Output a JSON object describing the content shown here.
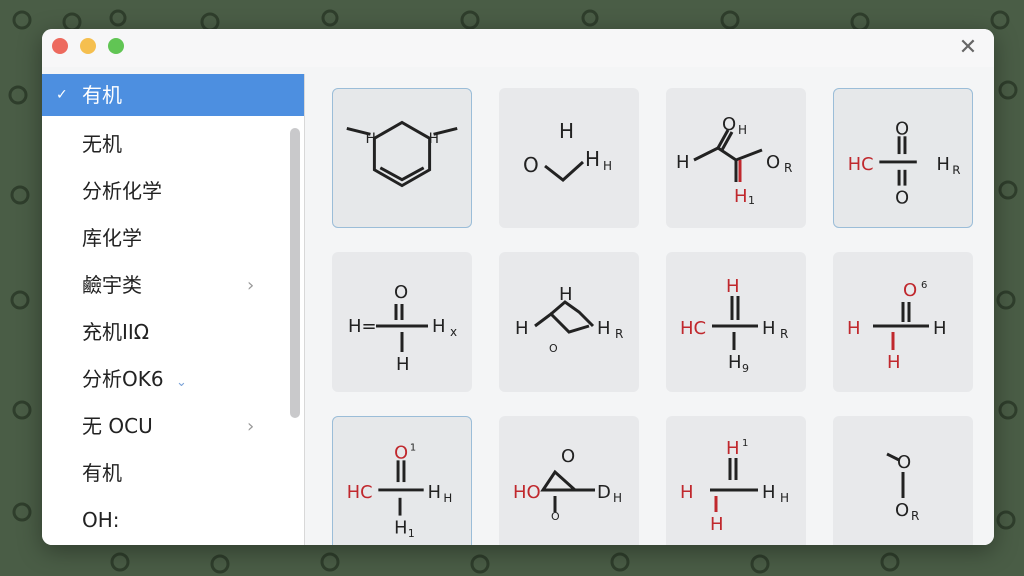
{
  "sidebar": {
    "items": [
      {
        "label": "有机",
        "selected": true,
        "check": "✓"
      },
      {
        "label": "无机"
      },
      {
        "label": "分析化学"
      },
      {
        "label": "库化学"
      },
      {
        "label": "鹼宇类",
        "chevron": "›"
      },
      {
        "label": "充机ⅠⅠΩ"
      },
      {
        "label": "分析OK6",
        "chevron_inline": "⌄"
      },
      {
        "label": "无 OCU",
        "chevron": "›"
      },
      {
        "label": "有机"
      },
      {
        "label": "OH:"
      }
    ]
  },
  "window": {
    "close_label": "✕"
  },
  "tiles": [
    {
      "labels": [
        "H",
        "H"
      ]
    },
    {
      "labels": [
        "H",
        "O",
        "H",
        "H"
      ]
    },
    {
      "labels": [
        "O",
        "H",
        "H",
        "O",
        "R",
        "H",
        "1"
      ]
    },
    {
      "labels": [
        "O",
        "HC",
        "H",
        "R",
        "O"
      ]
    },
    {
      "labels": [
        "O",
        "H=",
        "H",
        "x",
        "H"
      ]
    },
    {
      "labels": [
        "H",
        "H",
        "H",
        "R",
        "O"
      ]
    },
    {
      "labels": [
        "H",
        "HC",
        "H",
        "R",
        "H",
        "9"
      ]
    },
    {
      "labels": [
        "O",
        "6",
        "H",
        "H",
        "H"
      ]
    },
    {
      "labels": [
        "O",
        "1",
        "HC",
        "H",
        "H",
        "H",
        "1"
      ]
    },
    {
      "labels": [
        "O",
        "HO",
        "D",
        "H",
        "O"
      ]
    },
    {
      "labels": [
        "H",
        "1",
        "H",
        "H",
        "H",
        "H"
      ]
    },
    {
      "labels": [
        "O",
        "O",
        "R"
      ]
    }
  ],
  "colors": {
    "accent": "#4d8fe0",
    "red_atom": "#c0282d",
    "background": "#4a5d46"
  }
}
